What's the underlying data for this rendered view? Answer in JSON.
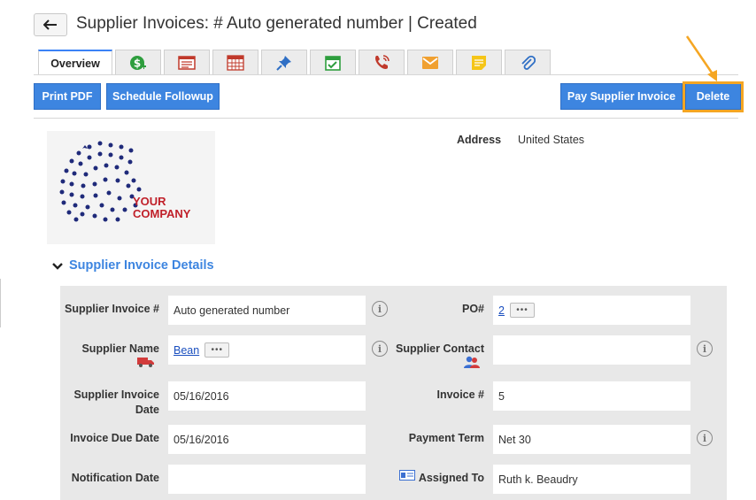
{
  "header": {
    "title": "Supplier Invoices: # Auto generated number | Created"
  },
  "tabs": [
    {
      "label": "Overview",
      "icon": "overview"
    },
    {
      "label": "",
      "icon": "money-icon"
    },
    {
      "label": "",
      "icon": "invoice-list-icon"
    },
    {
      "label": "",
      "icon": "calendar-grid-icon"
    },
    {
      "label": "",
      "icon": "pin-icon"
    },
    {
      "label": "",
      "icon": "calendar-check-icon"
    },
    {
      "label": "",
      "icon": "phone-icon"
    },
    {
      "label": "",
      "icon": "mail-icon"
    },
    {
      "label": "",
      "icon": "note-icon"
    },
    {
      "label": "",
      "icon": "paperclip-icon"
    }
  ],
  "toolbar": {
    "print_pdf": "Print PDF",
    "schedule_followup": "Schedule Followup",
    "pay_invoice": "Pay Supplier Invoice",
    "delete": "Delete"
  },
  "logo": {
    "line1": "YOUR",
    "line2": "COMPANY"
  },
  "address": {
    "label": "Address",
    "value": "United States"
  },
  "section": {
    "title": "Supplier Invoice Details"
  },
  "fields": {
    "supplier_invoice_num": {
      "label": "Supplier Invoice #",
      "value": "Auto generated number"
    },
    "po_num": {
      "label": "PO#",
      "value": "2"
    },
    "supplier_name": {
      "label": "Supplier Name",
      "value": "Bean"
    },
    "supplier_contact": {
      "label": "Supplier Contact",
      "value": ""
    },
    "supplier_invoice_date": {
      "label_line1": "Supplier Invoice",
      "label_line2": "Date",
      "value": "05/16/2016"
    },
    "invoice_num": {
      "label": "Invoice #",
      "value": "5"
    },
    "invoice_due_date": {
      "label": "Invoice Due Date",
      "value": "05/16/2016"
    },
    "payment_term": {
      "label": "Payment Term",
      "value": "Net 30"
    },
    "notification_date": {
      "label": "Notification Date",
      "value": ""
    },
    "assigned_to": {
      "label": "Assigned To",
      "value": "Ruth k. Beaudry"
    }
  },
  "colors": {
    "accent": "#3d85e0",
    "highlight": "#f5a623"
  }
}
